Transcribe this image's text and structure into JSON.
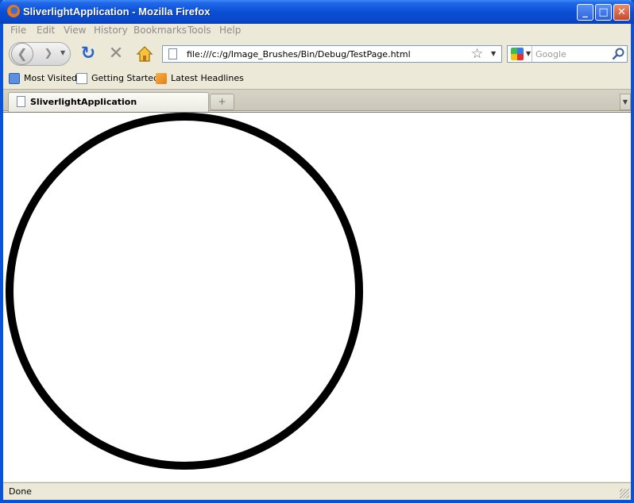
{
  "window": {
    "title": "SliverlightApplication - Mozilla Firefox",
    "caption_buttons": {
      "minimize": "_",
      "maximize": "□",
      "close": "✕"
    }
  },
  "menu": [
    "File",
    "Edit",
    "View",
    "History",
    "Bookmarks",
    "Tools",
    "Help"
  ],
  "nav": {
    "url": "file:///c:/g/Image_Brushes/Bin/Debug/TestPage.html",
    "search_placeholder": "Google"
  },
  "bookmarks": [
    "Most Visited",
    "Getting Started",
    "Latest Headlines"
  ],
  "tabs": [
    {
      "label": "SliverlightApplication"
    }
  ],
  "content": {
    "circle_stroke_color": "#000000"
  },
  "status": {
    "text": "Done"
  },
  "icons": [
    "firefox-icon",
    "back-arrow-icon",
    "forward-arrow-icon",
    "reload-icon",
    "stop-icon",
    "home-icon",
    "page-icon",
    "star-icon",
    "google-icon",
    "search-go-icon",
    "rss-icon",
    "new-tab-icon",
    "tab-list-icon",
    "resize-grip-icon"
  ]
}
